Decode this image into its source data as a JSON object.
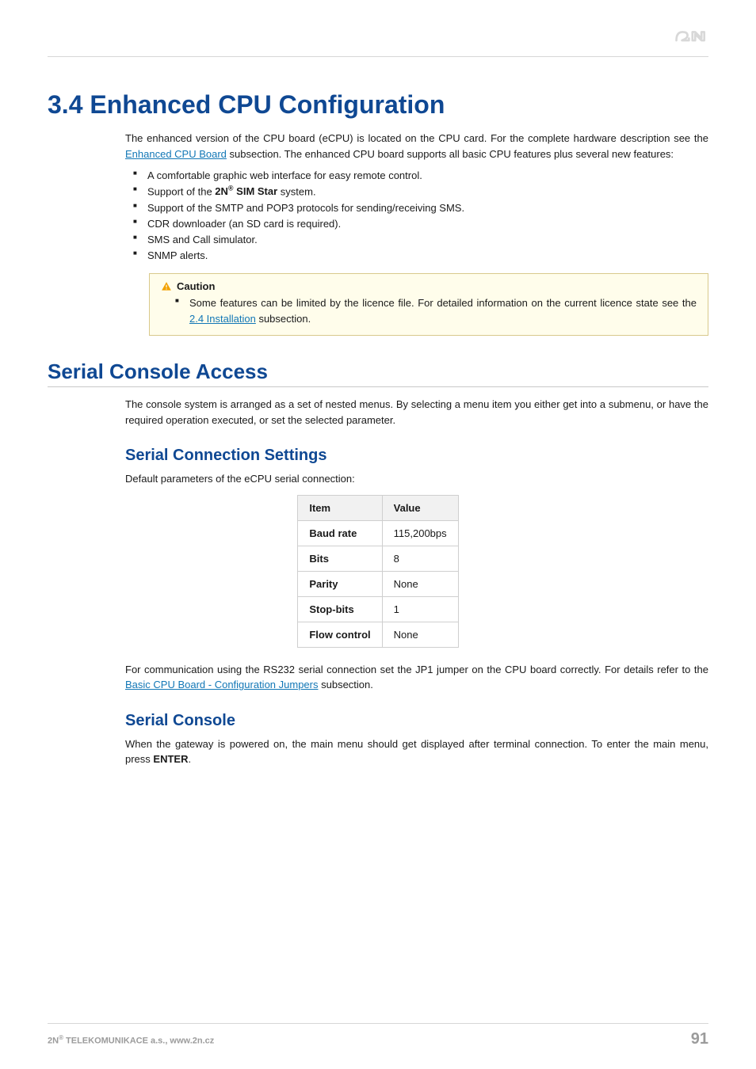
{
  "section_number": "3.4",
  "section_title": "Enhanced CPU Configuration",
  "intro_part1": "The enhanced version of the CPU board (eCPU) is located on the CPU card. For the complete hardware description see the ",
  "intro_link1": "Enhanced CPU Board",
  "intro_part2": " subsection. The enhanced CPU board supports all basic CPU features plus several new features:",
  "feature_list": {
    "f1": "A comfortable graphic web interface for easy remote control.",
    "f2_a": "Support of the ",
    "f2_brand": "2N",
    "f2_b": " SIM Star",
    "f2_c": " system.",
    "f3": "Support of the SMTP and POP3 protocols for sending/receiving SMS.",
    "f4": "CDR downloader (an SD card is required).",
    "f5": "SMS and Call simulator.",
    "f6": "SNMP alerts."
  },
  "callout": {
    "title": "Caution",
    "text_a": "Some features can be limited by the licence file. For detailed information on the current licence state see the ",
    "link": "2.4 Installation",
    "text_b": " subsection."
  },
  "h2_serial": "Serial Console Access",
  "serial_intro": "The console system is arranged as a set of nested menus. By selecting a menu item you either get into a submenu, or have the required operation executed, or set the selected parameter.",
  "h3_settings": "Serial Connection Settings",
  "settings_intro": "Default parameters of the eCPU serial connection:",
  "table": {
    "head_item": "Item",
    "head_value": "Value",
    "rows": [
      {
        "item": "Baud rate",
        "value": "115,200bps"
      },
      {
        "item": "Bits",
        "value": "8"
      },
      {
        "item": "Parity",
        "value": "None"
      },
      {
        "item": "Stop-bits",
        "value": "1"
      },
      {
        "item": "Flow control",
        "value": "None"
      }
    ]
  },
  "rs232": {
    "a": "For communication using the RS232 serial connection set the JP1 jumper on the CPU board correctly. For details refer to the ",
    "link": "Basic CPU Board - Configuration Jumpers",
    "b": " subsection."
  },
  "h3_console": "Serial Console",
  "console_text_a": "When the gateway is powered on, the main menu should get displayed after terminal connection. To enter the main menu, press ",
  "console_text_enter": "ENTER",
  "console_text_b": ".",
  "footer": {
    "company_a": "2N",
    "company_b": " TELEKOMUNIKACE a.s., www.2n.cz",
    "page": "91"
  }
}
